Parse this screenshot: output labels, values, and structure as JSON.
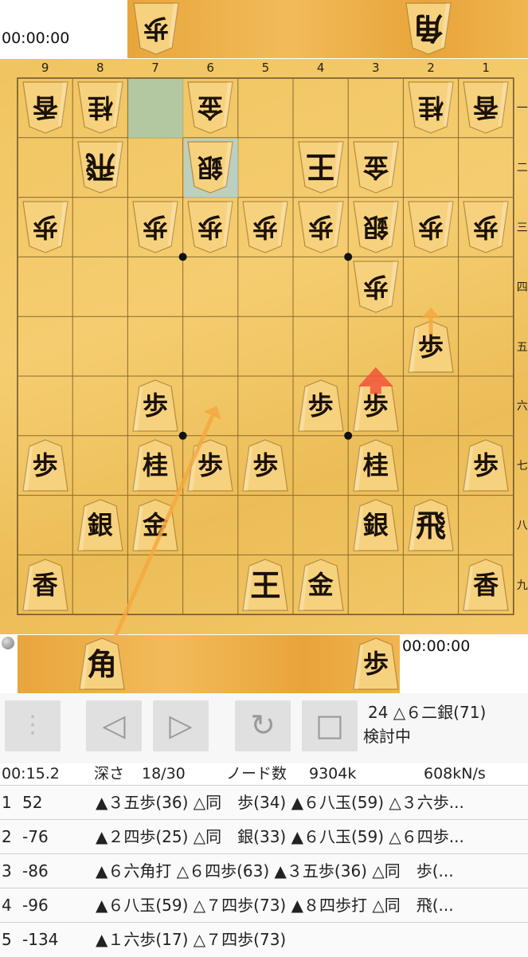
{
  "timers": {
    "top": "00:00:00",
    "bottom": "00:00:00"
  },
  "hands": {
    "gote": [
      {
        "char": "歩",
        "name": "gote-hand-pawn"
      },
      {
        "char": "角",
        "name": "gote-hand-bishop"
      }
    ],
    "sente": [
      {
        "char": "角",
        "name": "sente-hand-bishop"
      },
      {
        "char": "歩",
        "name": "sente-hand-pawn"
      }
    ]
  },
  "board": {
    "files": [
      "9",
      "8",
      "7",
      "6",
      "5",
      "4",
      "3",
      "2",
      "1"
    ],
    "ranks": [
      "一",
      "二",
      "三",
      "四",
      "五",
      "六",
      "七",
      "八",
      "九"
    ],
    "pieces": [
      {
        "file": 9,
        "rank": 1,
        "char": "香",
        "side": "gote"
      },
      {
        "file": 8,
        "rank": 1,
        "char": "桂",
        "side": "gote"
      },
      {
        "file": 6,
        "rank": 1,
        "char": "金",
        "side": "gote"
      },
      {
        "file": 2,
        "rank": 1,
        "char": "桂",
        "side": "gote"
      },
      {
        "file": 1,
        "rank": 1,
        "char": "香",
        "side": "gote"
      },
      {
        "file": 8,
        "rank": 2,
        "char": "飛",
        "side": "gote"
      },
      {
        "file": 6,
        "rank": 2,
        "char": "銀",
        "side": "gote"
      },
      {
        "file": 4,
        "rank": 2,
        "char": "王",
        "side": "gote"
      },
      {
        "file": 3,
        "rank": 2,
        "char": "金",
        "side": "gote"
      },
      {
        "file": 9,
        "rank": 3,
        "char": "歩",
        "side": "gote"
      },
      {
        "file": 7,
        "rank": 3,
        "char": "歩",
        "side": "gote"
      },
      {
        "file": 6,
        "rank": 3,
        "char": "歩",
        "side": "gote"
      },
      {
        "file": 5,
        "rank": 3,
        "char": "歩",
        "side": "gote"
      },
      {
        "file": 4,
        "rank": 3,
        "char": "歩",
        "side": "gote"
      },
      {
        "file": 3,
        "rank": 3,
        "char": "銀",
        "side": "gote"
      },
      {
        "file": 2,
        "rank": 3,
        "char": "歩",
        "side": "gote"
      },
      {
        "file": 1,
        "rank": 3,
        "char": "歩",
        "side": "gote"
      },
      {
        "file": 3,
        "rank": 4,
        "char": "歩",
        "side": "gote"
      },
      {
        "file": 2,
        "rank": 5,
        "char": "歩",
        "side": "sente"
      },
      {
        "file": 7,
        "rank": 6,
        "char": "歩",
        "side": "sente"
      },
      {
        "file": 4,
        "rank": 6,
        "char": "歩",
        "side": "sente"
      },
      {
        "file": 3,
        "rank": 6,
        "char": "歩",
        "side": "sente"
      },
      {
        "file": 9,
        "rank": 7,
        "char": "歩",
        "side": "sente"
      },
      {
        "file": 7,
        "rank": 7,
        "char": "桂",
        "side": "sente"
      },
      {
        "file": 6,
        "rank": 7,
        "char": "歩",
        "side": "sente"
      },
      {
        "file": 5,
        "rank": 7,
        "char": "歩",
        "side": "sente"
      },
      {
        "file": 3,
        "rank": 7,
        "char": "桂",
        "side": "sente"
      },
      {
        "file": 1,
        "rank": 7,
        "char": "歩",
        "side": "sente"
      },
      {
        "file": 8,
        "rank": 8,
        "char": "銀",
        "side": "sente"
      },
      {
        "file": 7,
        "rank": 8,
        "char": "金",
        "side": "sente"
      },
      {
        "file": 3,
        "rank": 8,
        "char": "銀",
        "side": "sente"
      },
      {
        "file": 2,
        "rank": 8,
        "char": "飛",
        "side": "sente"
      },
      {
        "file": 9,
        "rank": 9,
        "char": "香",
        "side": "sente"
      },
      {
        "file": 5,
        "rank": 9,
        "char": "王",
        "side": "sente"
      },
      {
        "file": 4,
        "rank": 9,
        "char": "金",
        "side": "sente"
      },
      {
        "file": 1,
        "rank": 9,
        "char": "香",
        "side": "sente"
      }
    ],
    "last_move": {
      "from_file": 7,
      "from_rank": 1,
      "to_file": 6,
      "to_rank": 2
    },
    "arrows": [
      {
        "from": "hand-bishop",
        "to_file": 6,
        "to_rank": 6,
        "color": "#f5a840"
      },
      {
        "from_file": 2,
        "from_rank": 5,
        "to_file": 2,
        "to_rank": 4,
        "color": "#f5a840"
      },
      {
        "from_file": 3,
        "from_rank": 6,
        "to_file": 3,
        "to_rank": 5,
        "color": "#f2553a"
      }
    ]
  },
  "controls": {
    "menu_icon": "vertical-dots-icon",
    "prev_icon": "◁",
    "next_icon": "▷",
    "rotate_icon": "↻",
    "stop_icon": "□",
    "last_move": "24 △６二銀(71)",
    "mode": "検討中"
  },
  "status": {
    "elapsed": "00:15.2",
    "depth_label": "深さ",
    "depth": "18/30",
    "nodes_label": "ノード数",
    "nodes": "9304k",
    "speed": "608kN/s"
  },
  "pv": [
    {
      "rank": "1",
      "score": "52",
      "line": "▲３五歩(36) △同　歩(34) ▲６八玉(59) △３六歩..."
    },
    {
      "rank": "2",
      "score": "-76",
      "line": "▲２四歩(25) △同　銀(33) ▲６八玉(59) △６四歩..."
    },
    {
      "rank": "3",
      "score": "-86",
      "line": "▲６六角打 △６四歩(63) ▲３五歩(36) △同　歩(..."
    },
    {
      "rank": "4",
      "score": "-96",
      "line": "▲６八玉(59) △７四歩(73) ▲８四歩打 △同　飛(..."
    },
    {
      "rank": "5",
      "score": "-134",
      "line": "▲１六歩(17) △７四歩(73)"
    }
  ]
}
